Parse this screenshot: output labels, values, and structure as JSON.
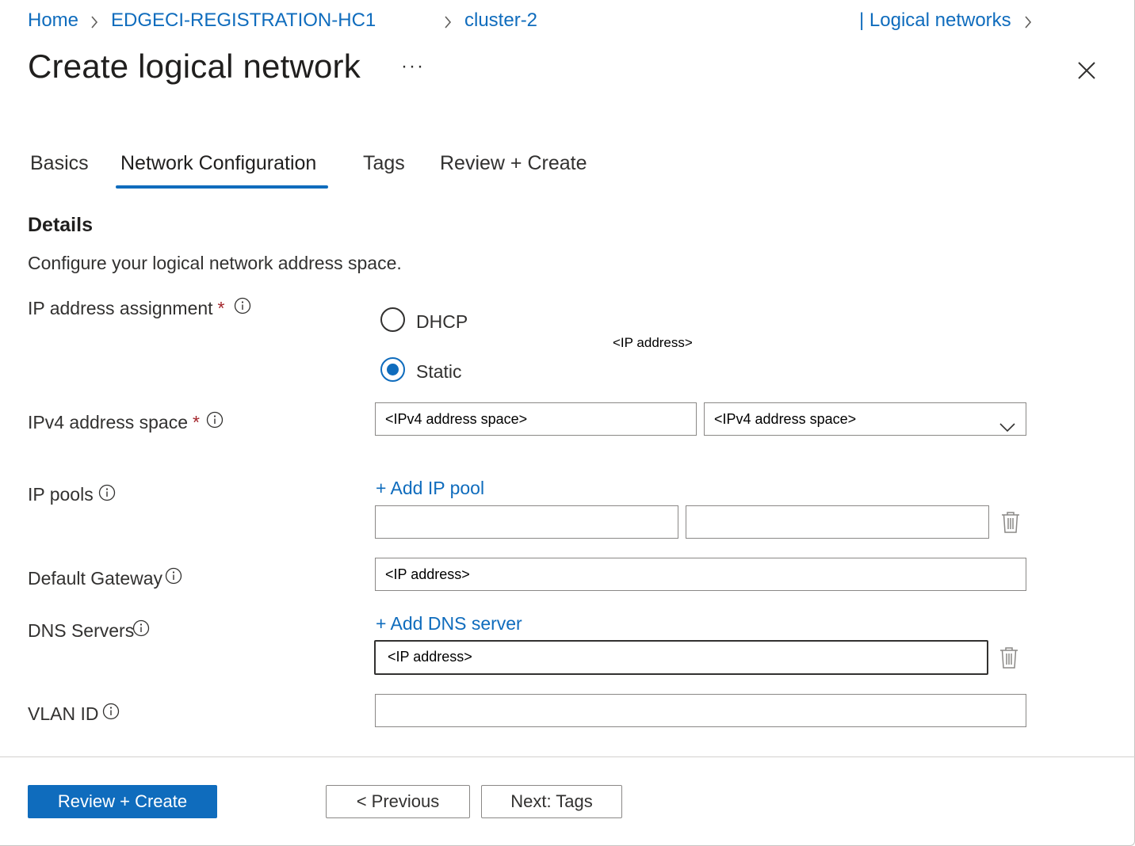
{
  "breadcrumb": {
    "home": "Home",
    "resource_group": "EDGECI-REGISTRATION-HC1",
    "cluster": "cluster-2",
    "section": "| Logical networks"
  },
  "page": {
    "title": "Create logical network",
    "more": "···"
  },
  "tabs": [
    {
      "label": "Basics",
      "active": false
    },
    {
      "label": "Network Configuration",
      "active": true
    },
    {
      "label": "Tags",
      "active": false
    },
    {
      "label": "Review + Create",
      "active": false
    }
  ],
  "details": {
    "heading": "Details",
    "description": "Configure your logical network address space."
  },
  "form": {
    "ip_assignment": {
      "label": "IP address assignment",
      "required": "*",
      "options": [
        {
          "label": "DHCP",
          "checked": false
        },
        {
          "label": "Static",
          "checked": true
        }
      ],
      "floating_text": "<IP address>"
    },
    "ipv4_space": {
      "label": "IPv4 address space",
      "required": "*",
      "value": "<IPv4 address space>",
      "select_value": "<IPv4 address space>"
    },
    "ip_pools": {
      "label": "IP pools",
      "add_label": "+ Add IP pool",
      "start_value": "",
      "end_value": ""
    },
    "gateway": {
      "label": "Default Gateway",
      "value": "<IP address>"
    },
    "dns": {
      "label": "DNS Servers",
      "add_label": "+ Add DNS server",
      "value": "<IP address>"
    },
    "vlan": {
      "label": "VLAN ID",
      "value": ""
    }
  },
  "footer": {
    "review_create": "Review + Create",
    "previous": "< Previous",
    "next": "Next: Tags"
  },
  "colors": {
    "accent": "#0f6cbd",
    "required": "#a4262c",
    "text": "#323130"
  }
}
